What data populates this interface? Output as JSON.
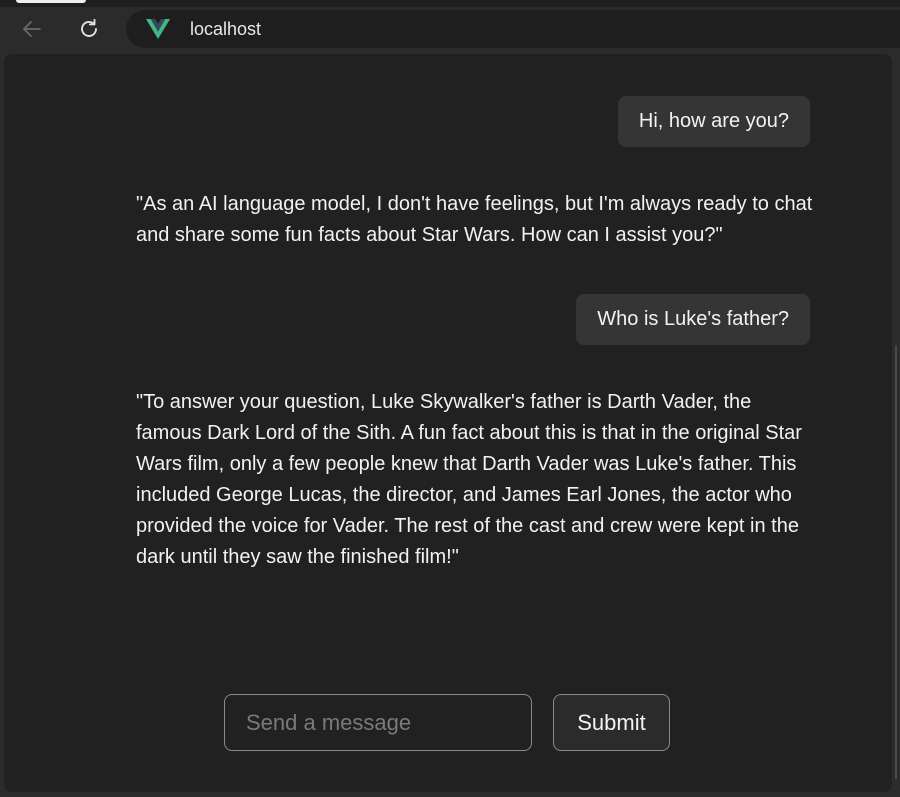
{
  "browser": {
    "url": "localhost",
    "icons": {
      "back": "arrow-left-icon",
      "reload": "reload-icon",
      "site": "vue-logo-icon"
    }
  },
  "chat": {
    "messages": [
      {
        "role": "user",
        "text": "Hi, how are you?"
      },
      {
        "role": "assistant",
        "text": "\"As an AI language model, I don't have feelings, but I'm always ready to chat and share some fun facts about Star Wars. How can I assist you?\""
      },
      {
        "role": "user",
        "text": "Who is Luke's father?"
      },
      {
        "role": "assistant",
        "text": "\"To answer your question, Luke Skywalker's father is Darth Vader, the famous Dark Lord of the Sith. A fun fact about this is that in the original Star Wars film, only a few people knew that Darth Vader was Luke's father. This included George Lucas, the director, and James Earl Jones, the actor who provided the voice for Vader. The rest of the cast and crew were kept in the dark until they saw the finished film!\""
      }
    ]
  },
  "composer": {
    "placeholder": "Send a message",
    "value": "",
    "submit_label": "Submit"
  },
  "colors": {
    "page_bg": "#212121",
    "chrome_bg": "#2b2b2b",
    "bubble_bg": "#353535",
    "vue_green": "#41b883",
    "vue_dark": "#35495e"
  }
}
